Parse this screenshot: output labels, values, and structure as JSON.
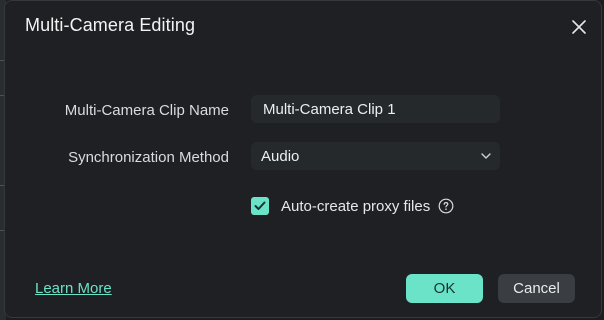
{
  "dialog": {
    "title": "Multi-Camera Editing",
    "close_icon": "close-icon"
  },
  "form": {
    "clip_name_label": "Multi-Camera Clip Name",
    "clip_name_value": "Multi-Camera Clip 1",
    "sync_label": "Synchronization Method",
    "sync_value": "Audio",
    "sync_icon": "chevron-down-icon",
    "proxy_checked": true,
    "proxy_label": "Auto-create proxy files",
    "proxy_help_icon": "help-circle-icon"
  },
  "footer": {
    "learn_more": "Learn More",
    "ok_label": "OK",
    "cancel_label": "Cancel"
  },
  "colors": {
    "accent": "#6ae3c8",
    "dialog_bg": "#1e2023",
    "field_bg": "#26292c",
    "cancel_bg": "#3a3d41"
  }
}
